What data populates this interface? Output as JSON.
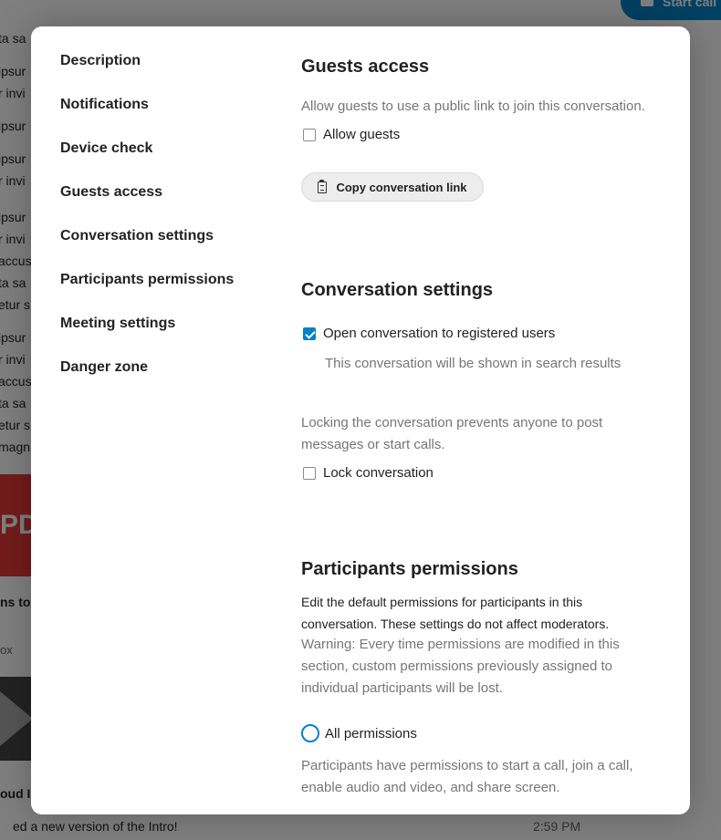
{
  "background": {
    "call_button_label": "Start call",
    "snippet_lines": [
      "ta sa",
      "ipsur",
      "r invi",
      "ipsur",
      "ipsur",
      "r invi",
      "ipsur",
      "r invi",
      "accus",
      "ta sa",
      "etur s",
      "ipsur",
      "r invi",
      "accus",
      "ta sa",
      "etur s",
      "magn"
    ],
    "thumb_text": "PD",
    "bold_text": "ns to",
    "small_text": "ox",
    "bold_text_2": "oud I",
    "message_text": "ed a new version of the Intro!",
    "message_time": "2:59 PM"
  },
  "nav": {
    "items": [
      {
        "label": "Description"
      },
      {
        "label": "Notifications"
      },
      {
        "label": "Device check"
      },
      {
        "label": "Guests access"
      },
      {
        "label": "Conversation settings"
      },
      {
        "label": "Participants permissions"
      },
      {
        "label": "Meeting settings"
      },
      {
        "label": "Danger zone"
      }
    ]
  },
  "guests": {
    "title": "Guests access",
    "hint": "Allow guests to use a public link to join this conversation.",
    "allow_label": "Allow guests",
    "allow_checked": false,
    "copy_label": "Copy conversation link",
    "copy_icon": "clipboard-icon"
  },
  "conversation": {
    "title": "Conversation settings",
    "open_label": "Open conversation to registered users",
    "open_checked": true,
    "open_hint": "This conversation will be shown in search results",
    "lock_hint": "Locking the conversation prevents anyone to post messages or start calls.",
    "lock_label": "Lock conversation",
    "lock_checked": false
  },
  "permissions": {
    "title": "Participants permissions",
    "description": "Edit the default permissions for participants in this conversation. These settings do not affect moderators.",
    "warning": "Warning: Every time permissions are modified in this section, custom permissions previously assigned to individual participants will be lost.",
    "all_label": "All permissions",
    "all_hint": "Participants have permissions to start a call, join a call, enable audio and video, and share screen."
  },
  "colors": {
    "accent": "#0082c9",
    "muted_text": "#767676"
  }
}
